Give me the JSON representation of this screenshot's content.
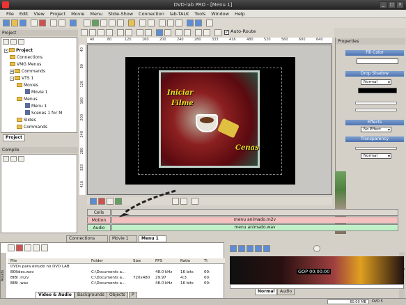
{
  "window": {
    "title": "DVD-lab PRO - [Menu 1]"
  },
  "menubar": [
    "File",
    "Edit",
    "View",
    "Project",
    "Movie",
    "Menu",
    "Slide-Show",
    "Connection",
    "lab-TALK",
    "Tools",
    "Window",
    "Help"
  ],
  "toolbar": {
    "autoroute_label": "Auto-Route",
    "autoroute_checked": "✓"
  },
  "project_panel": {
    "title": "Project",
    "tree": [
      {
        "label": "Project",
        "depth": 0,
        "bold": true,
        "icon": "folder"
      },
      {
        "label": "Connections",
        "depth": 1,
        "icon": "folder"
      },
      {
        "label": "VMG Menus",
        "depth": 1,
        "icon": "folder"
      },
      {
        "label": "Commands",
        "depth": 1,
        "icon": "folder"
      },
      {
        "label": "VTS 1",
        "depth": 1,
        "icon": "folder"
      },
      {
        "label": "Movies",
        "depth": 2,
        "icon": "folder"
      },
      {
        "label": "Movie 1",
        "depth": 3,
        "icon": "doc"
      },
      {
        "label": "Menus",
        "depth": 2,
        "icon": "folder"
      },
      {
        "label": "Menu 1",
        "depth": 3,
        "icon": "doc"
      },
      {
        "label": "Scenes 1 for M",
        "depth": 3,
        "icon": "doc"
      },
      {
        "label": "Slides",
        "depth": 2,
        "icon": "folder"
      },
      {
        "label": "Commands",
        "depth": 2,
        "icon": "folder"
      }
    ],
    "tab": "Project"
  },
  "compile_panel": {
    "title": "Compile"
  },
  "ruler": {
    "h_ticks": [
      "40",
      "80",
      "120",
      "160",
      "200",
      "240",
      "280",
      "333",
      "416",
      "480",
      "520",
      "560",
      "600",
      "640"
    ],
    "v_ticks": [
      "40",
      "80",
      "120",
      "160",
      "200",
      "240",
      "280",
      "333",
      "416"
    ]
  },
  "menu_canvas": {
    "title_line1": "Iniciar",
    "title_line2": "Filme",
    "scenes_label": "Cenas"
  },
  "properties": {
    "title": "Properties",
    "fill_color": "Fill Color",
    "drop_shadow": "Drop Shadow",
    "shadow_mode": "Normal",
    "effects": "Effects",
    "effect_value": "No Effect",
    "transparency": "Transparency",
    "transparency_mode": "Normal"
  },
  "timeline": {
    "cells_label": "Cells",
    "motion_label": "Motion",
    "motion_file": "menu animado.m2v",
    "audio_label": "Audio",
    "audio_file": "menu animado.wav"
  },
  "doc_tabs": [
    {
      "label": "Connections",
      "active": false
    },
    {
      "label": "Movie 1",
      "active": false
    },
    {
      "label": "Menu 1",
      "active": true
    }
  ],
  "assets": {
    "columns": [
      "File",
      "Folder",
      "Size",
      "FPS",
      "Ratio",
      "Ti"
    ],
    "rows": [
      {
        "file": "DVDs para estudo no DVD LAB",
        "folder": "",
        "size": "",
        "fps": "",
        "ratio": "",
        "ti": ""
      },
      {
        "file": "BOlides.wav",
        "folder": "C:\\Documents a...",
        "size": "",
        "fps": "48.0 kHz",
        "ratio": "16 bits",
        "ti": "00:"
      },
      {
        "file": "BIBI .m2v",
        "folder": "C:\\Documents a...",
        "size": "720x480",
        "fps": "29.97",
        "ratio": "4:3",
        "ti": "00:"
      },
      {
        "file": "BIBI .wav",
        "folder": "C:\\Documents a...",
        "size": "",
        "fps": "48.0 kHz",
        "ratio": "16 bits",
        "ti": "00:"
      }
    ],
    "side_label": "Assets",
    "tabs": [
      "Video & Audio",
      "Backgrounds",
      "Objects",
      "P"
    ]
  },
  "preview": {
    "timecode": "GOP 00:00:00",
    "tabs": [
      "Normal",
      "Audio"
    ],
    "side_label": "Preview"
  },
  "status": {
    "size": "60.00 MB",
    "format": "DVD 5"
  },
  "colors": {
    "accent_bar": "#5a7fc0",
    "motion_track": "#f4c0c0",
    "audio_track": "#c0f0c8",
    "canvas_bg": "#000000",
    "title_text": "#f0e020"
  }
}
